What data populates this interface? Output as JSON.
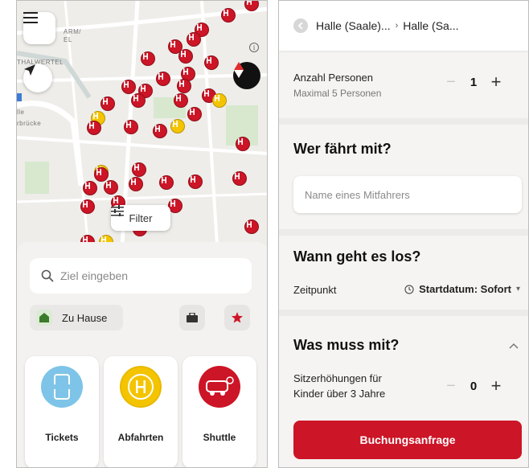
{
  "left": {
    "map": {
      "labels": [
        "ARM/",
        "EL",
        "THALWERTEL",
        "lle",
        "rbrücke"
      ],
      "filter_label": "Filter",
      "info_glyph": "i",
      "icons": [
        "menu-icon",
        "locate-arrow-icon",
        "info-icon",
        "compass-icon",
        "filter-sliders-icon",
        "bus-stop-icon"
      ],
      "colors": {
        "stop_red": "#cc1526",
        "stop_yellow": "#f4c400",
        "map_bg": "#eeede9"
      }
    },
    "search": {
      "placeholder": "Ziel eingeben"
    },
    "home": {
      "label": "Zu Hause"
    },
    "tiles": [
      {
        "label": "Tickets",
        "icon": "ticket-icon",
        "color": "#7ec4e8"
      },
      {
        "label": "Abfahrten",
        "icon": "bus-stop-icon",
        "color": "#f4c400"
      },
      {
        "label": "Shuttle",
        "icon": "shuttle-van-icon",
        "color": "#cc1526"
      }
    ]
  },
  "right": {
    "breadcrumb": {
      "from": "Halle (Saale)...",
      "separator": "›",
      "to": "Halle (Sa..."
    },
    "persons": {
      "label": "Anzahl Personen",
      "sub": "Maximal 5 Personen",
      "value": "1",
      "minus": "−",
      "plus": "+"
    },
    "who": {
      "title": "Wer fährt mit?",
      "placeholder": "Name eines Mitfahrers"
    },
    "when": {
      "title": "Wann geht es los?",
      "label": "Zeitpunkt",
      "value": "Startdatum: Sofort",
      "chevron": "▾"
    },
    "what": {
      "title": "Was muss mit?",
      "seat_label_line1": "Sitzerhöhungen für",
      "seat_label_line2": "Kinder über 3 Jahre",
      "value": "0",
      "minus": "−",
      "plus": "+"
    },
    "book_button": "Buchungsanfrage",
    "colors": {
      "accent": "#cc1526"
    }
  }
}
